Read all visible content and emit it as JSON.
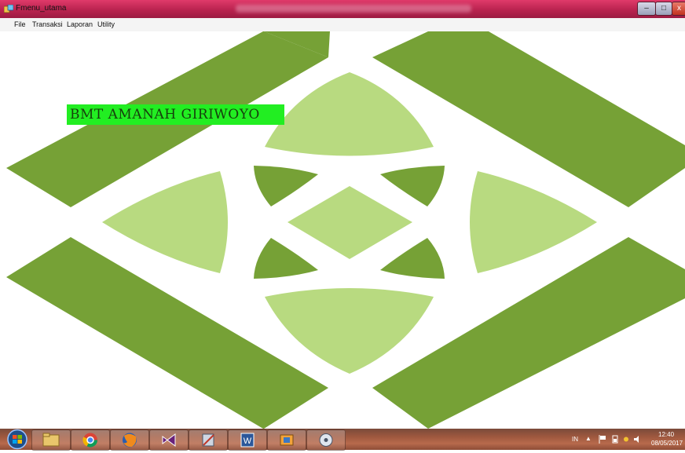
{
  "window": {
    "title": "Fmenu_utama",
    "icon": "app-icon"
  },
  "menu": [
    {
      "label": "File"
    },
    {
      "label": "Transaksi"
    },
    {
      "label": "Laporan"
    },
    {
      "label": "Utility"
    }
  ],
  "main": {
    "label": "BMT AMANAH GIRIWOYO"
  },
  "taskbar": {
    "apps": [
      "explorer-icon",
      "chrome-icon",
      "firefox-icon",
      "visual-studio-icon",
      "tools-icon",
      "word-icon",
      "folder-app-icon",
      "media-icon"
    ],
    "tray": {
      "language": "IN",
      "time": "12:40",
      "date": "08/05/2017"
    }
  },
  "colors": {
    "titlebar": "#b9234f",
    "logo_dark": "#76a136",
    "logo_light": "#b8da80",
    "label_bg": "#22ee22",
    "label_text": "#163f0c"
  }
}
